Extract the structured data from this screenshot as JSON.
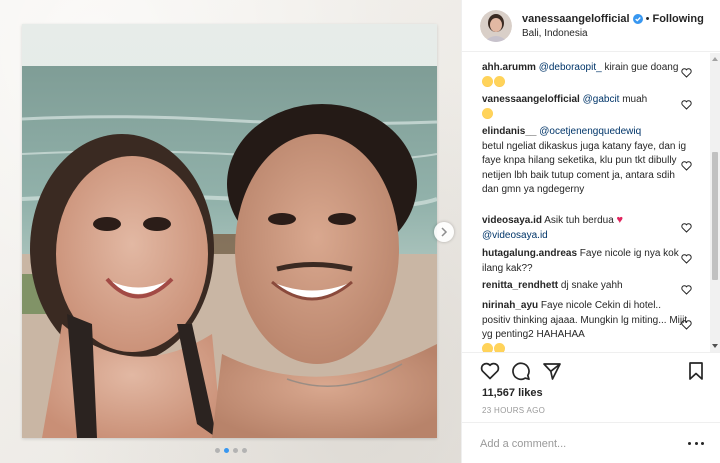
{
  "post": {
    "username": "vanessaangelofficial",
    "separator": "•",
    "follow_label": "Following",
    "location": "Bali, Indonesia",
    "likes": "11,567 likes",
    "timestamp": "23 HOURS AGO",
    "comment_placeholder": "Add a comment...",
    "carousel": {
      "total": 4,
      "active_index": 1
    }
  },
  "comments": [
    {
      "user": "ahh.arumm",
      "mention": "@deboraopit_",
      "text": " kirain gue doang",
      "emoji": [
        "laugh",
        "laugh"
      ]
    },
    {
      "user": "vanessaangelofficial",
      "mention": "@gabcit",
      "text": " muah",
      "emoji": [
        "smile"
      ]
    },
    {
      "user": "elindanis__",
      "mention": "@ocetjenengquedewiq",
      "text": "betul ngeliat dikaskus juga katany faye, dan ig faye knpa hilang seketika, klu pun tkt dibully netijen lbh baik tutup coment ja, antara sdih dan gmn ya ngdegerny",
      "emoji": []
    },
    {
      "user": "videosaya.id",
      "mention": "@videosaya.id",
      "text": "Asik tuh berdua",
      "emoji": [
        "red-heart"
      ]
    },
    {
      "user": "hutagalung.andreas",
      "mention": "",
      "text": "Faye nicole ig nya kok ilang kak??",
      "emoji": []
    },
    {
      "user": "renitta_rendhett",
      "mention": "",
      "text": "dj snake yahh",
      "emoji": []
    },
    {
      "user": "nirinah_ayu",
      "mention": "",
      "text": "Faye nicole Cekin di hotel.. positiv thinking ajaaa. Mungkin lg miting... Mijit yg penting2 HAHAHAA",
      "emoji": [
        "laugh",
        "laugh"
      ]
    }
  ],
  "icons": {
    "verified": "verified-badge-icon",
    "like": "heart-outline-icon",
    "comment": "speech-bubble-icon",
    "share": "paper-plane-icon",
    "save": "bookmark-icon",
    "next": "chevron-right-icon",
    "more": "more-options-icon"
  },
  "colors": {
    "accent": "#3897f0",
    "mention": "#003569",
    "muted": "#999999",
    "heart": "#e0245e"
  }
}
